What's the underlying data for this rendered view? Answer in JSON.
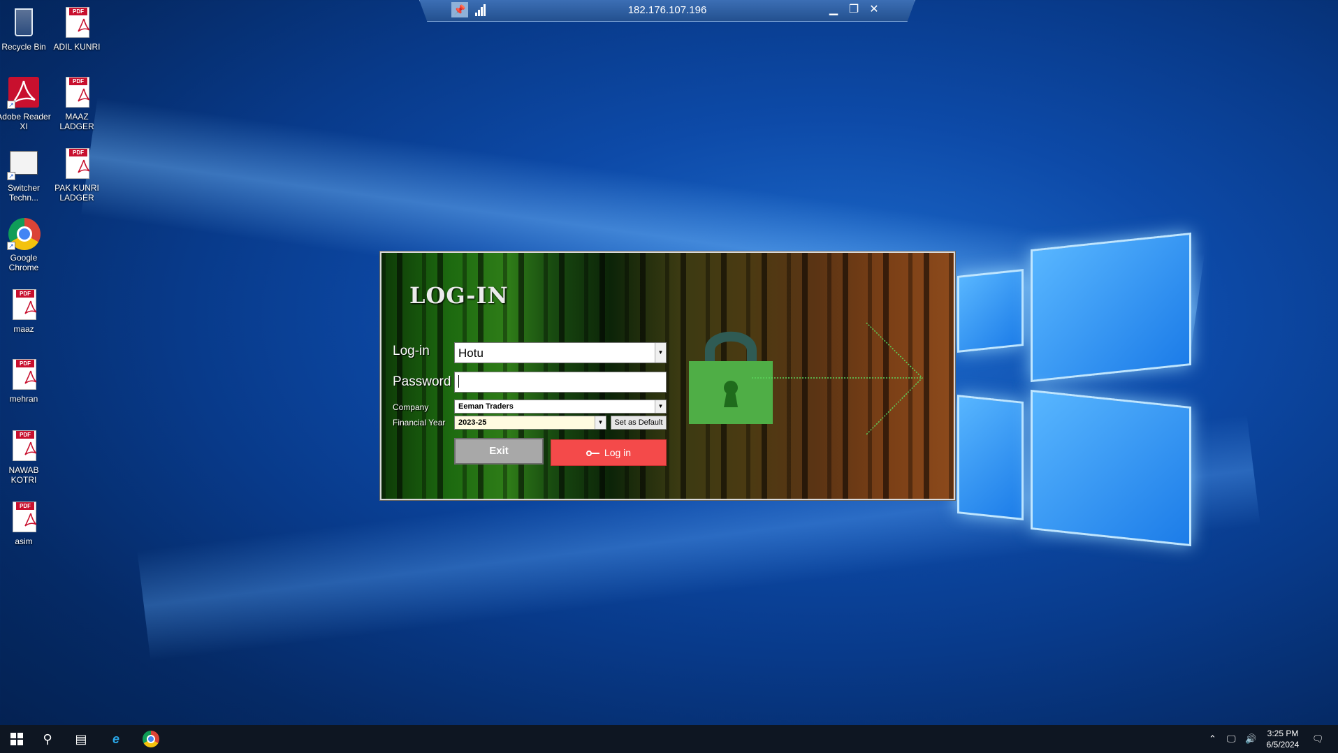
{
  "rdp": {
    "ip": "182.176.107.196"
  },
  "desktop": {
    "icons": [
      {
        "label": "Recycle Bin"
      },
      {
        "label": "ADIL KUNRI"
      },
      {
        "label": "Adobe Reader XI"
      },
      {
        "label": "MAAZ LADGER"
      },
      {
        "label": "Switcher Techn..."
      },
      {
        "label": "PAK KUNRI LADGER"
      },
      {
        "label": "Google Chrome"
      },
      {
        "label": "maaz"
      },
      {
        "label": "mehran"
      },
      {
        "label": "NAWAB KOTRI"
      },
      {
        "label": "asim"
      }
    ]
  },
  "login": {
    "title": "LOG-IN",
    "login_label": "Log-in",
    "login_value": "Hotu",
    "password_label": "Password",
    "password_value": "",
    "company_label": "Company",
    "company_value": "Eeman Traders",
    "year_label": "Financial Year",
    "year_value": "2023-25",
    "default_button": "Set as Default",
    "exit_button": "Exit",
    "login_button": "Log in",
    "login_button_color": "#f44a4a",
    "lock_color": "#4fae46"
  },
  "taskbar": {
    "pinned": [
      "start-icon",
      "search-icon",
      "task-view-icon",
      "internet-explorer-icon",
      "chrome-icon"
    ],
    "time": "3:25 PM",
    "date": "6/5/2024"
  }
}
